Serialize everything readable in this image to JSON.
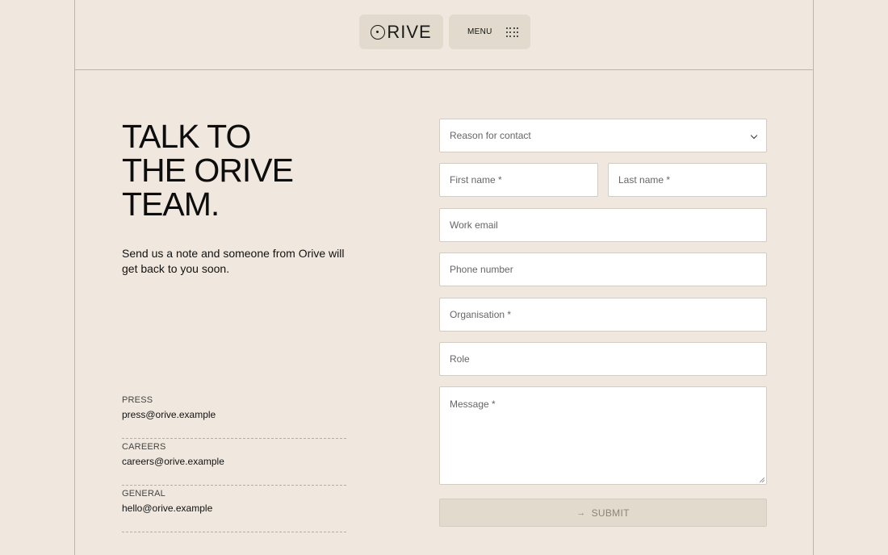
{
  "header": {
    "logo_text": "RIVE",
    "menu_label": "MENU"
  },
  "hero": {
    "headline_line1": "TALK TO",
    "headline_line2": "THE ORIVE",
    "headline_line3": "TEAM.",
    "intro": "Send us a note and someone from Orive will get back to you soon."
  },
  "contacts": [
    {
      "label": "PRESS",
      "email": "press@orive.example"
    },
    {
      "label": "CAREERS",
      "email": "careers@orive.example"
    },
    {
      "label": "GENERAL",
      "email": "hello@orive.example"
    }
  ],
  "form": {
    "reason_placeholder": "Reason for contact",
    "first_name_placeholder": "First name *",
    "last_name_placeholder": "Last name *",
    "email_placeholder": "Work email",
    "phone_placeholder": "Phone number",
    "org_placeholder": "Organisation *",
    "role_placeholder": "Role",
    "message_placeholder": "Message *",
    "submit_label": "SUBMIT"
  },
  "colors": {
    "background": "#f0e8de",
    "button_bg": "#e2dacd",
    "field_bg": "#ffffff",
    "border": "#bdb5aa"
  }
}
